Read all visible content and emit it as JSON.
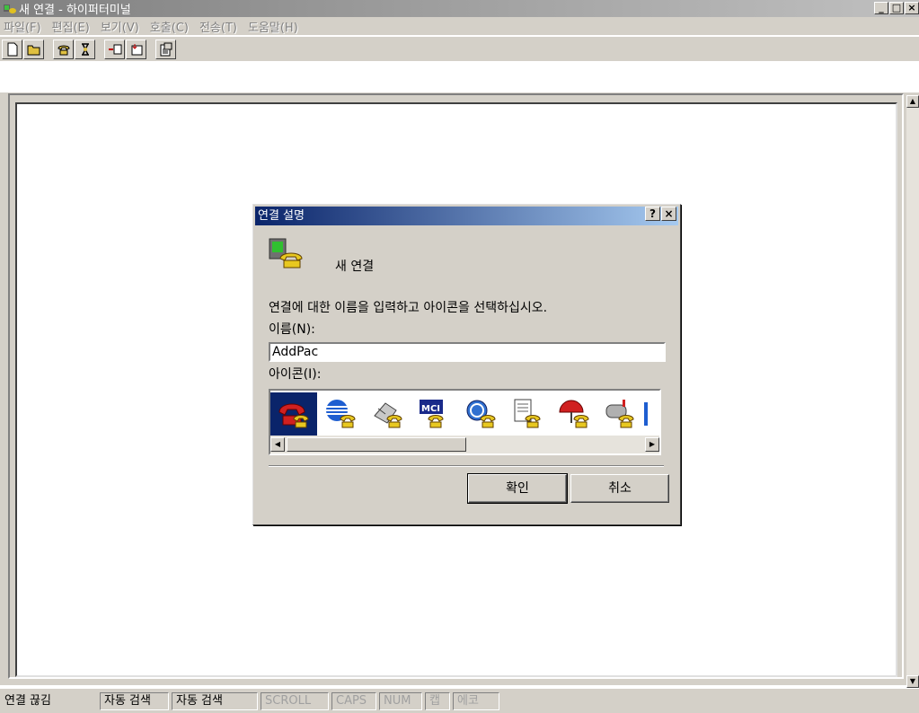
{
  "window": {
    "title": "새 연결 - 하이퍼터미널",
    "minimize": "_",
    "maximize": "□",
    "close": "×"
  },
  "menu": [
    "파일(F)",
    "편집(E)",
    "보기(V)",
    "호출(C)",
    "전송(T)",
    "도움말(H)"
  ],
  "toolbar_icons": [
    "new-document-icon",
    "open-folder-icon",
    "dial-icon",
    "disconnect-icon",
    "send-icon",
    "receive-icon",
    "properties-icon"
  ],
  "dialog": {
    "title": "연결 설명",
    "help": "?",
    "close": "×",
    "connection_name": "새 연결",
    "instruction": "연결에 대한 이름을 입력하고 아이콘을 선택하십시오.",
    "name_label": "이름(N):",
    "name_value": "AddPac",
    "icon_label": "아이콘(I):",
    "icons": [
      "red-phone-icon",
      "globe-phone-icon",
      "fax-phone-icon",
      "mci-phone-icon",
      "ge-phone-icon",
      "document-phone-icon",
      "umbrella-phone-icon",
      "mailbox-phone-icon"
    ],
    "selected_icon": 0,
    "ok": "확인",
    "cancel": "취소"
  },
  "status": {
    "connection": "연결 끊김",
    "detect1": "자동 검색",
    "detect2": "자동 검색",
    "scroll": "SCROLL",
    "caps": "CAPS",
    "num": "NUM",
    "capture": "캡",
    "echo": "에코"
  },
  "colors": {
    "face": "#d4d0c8",
    "dialog_title": "#0a246a",
    "selection": "#0a246a"
  }
}
